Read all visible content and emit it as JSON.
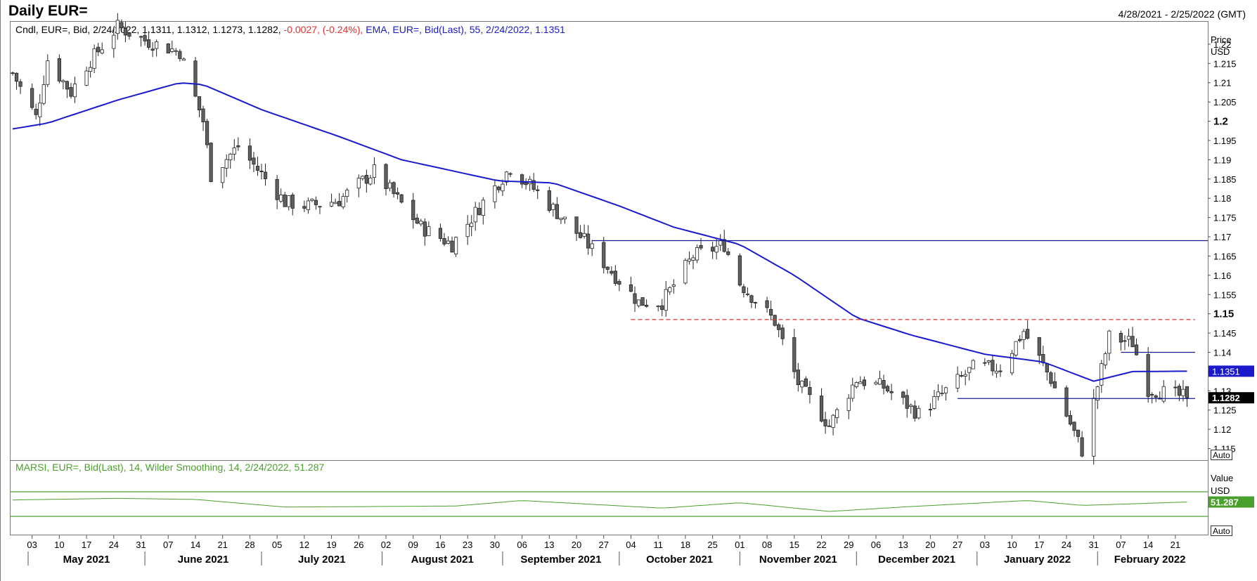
{
  "header": {
    "title": "Daily EUR=",
    "date_range": "4/28/2021 - 2/25/2022 (GMT)"
  },
  "legend": {
    "candle_info": "Cndl, EUR=, Bid, 2/24/2022, 1.1311, 1.1312, 1.1273, 1.1282,",
    "candle_change": "-0.0027, (-0.24%),",
    "ema_info": "EMA, EUR=, Bid(Last), 55, 2/24/2022, 1.1351",
    "rsi_info": "MARSI, EUR=, Bid(Last), 14, Wilder Smoothing, 14, 2/24/2022, 51.287"
  },
  "price_axis": {
    "title_line1": "Price",
    "title_line2": "USD",
    "ticks": [
      "1.22",
      "1.215",
      "1.21",
      "1.205",
      "1.2",
      "1.195",
      "1.19",
      "1.185",
      "1.18",
      "1.175",
      "1.17",
      "1.165",
      "1.16",
      "1.155",
      "1.15",
      "1.145",
      "1.14",
      "1.135",
      "1.13",
      "1.125",
      "1.12",
      "1.115"
    ],
    "bold_ticks": [
      "1.2",
      "1.15"
    ],
    "auto_label": "Auto",
    "ema_tag": "1.1351",
    "last_tag": "1.1282"
  },
  "rsi_axis": {
    "title_line1": "Value",
    "title_line2": "USD",
    "value_tag": "51.287",
    "auto_label": "Auto"
  },
  "x_axis": {
    "day_ticks": [
      "03",
      "10",
      "17",
      "24",
      "31",
      "07",
      "14",
      "21",
      "28",
      "05",
      "12",
      "19",
      "26",
      "02",
      "09",
      "16",
      "23",
      "30",
      "06",
      "13",
      "20",
      "27",
      "04",
      "11",
      "18",
      "25",
      "01",
      "08",
      "15",
      "22",
      "29",
      "06",
      "13",
      "20",
      "27",
      "03",
      "10",
      "17",
      "24",
      "31",
      "07",
      "14",
      "21"
    ],
    "months": [
      "May 2021",
      "June 2021",
      "July 2021",
      "August 2021",
      "September 2021",
      "October 2021",
      "November 2021",
      "December 2021",
      "January 2022",
      "February 2022"
    ]
  },
  "colors": {
    "up_candle": "#ffffff",
    "down_candle": "#606060",
    "ema": "#1a1acc",
    "rsi": "#4aa02c",
    "resistance_line": "#1a1a8c",
    "dashed_line": "#e03030",
    "change_text": "#e03030",
    "ema_text": "#1a1acc"
  },
  "chart_data": {
    "type": "candlestick",
    "title": "Daily EUR=",
    "instrument": "EUR=",
    "date_range": [
      "2021-04-28",
      "2022-02-25"
    ],
    "ylim": [
      1.112,
      1.226
    ],
    "last": {
      "date": "2/24/2022",
      "open": 1.1311,
      "high": 1.1312,
      "low": 1.1273,
      "close": 1.1282,
      "change": -0.0027,
      "change_pct": -0.24
    },
    "ema_period": 55,
    "ema_last": 1.1351,
    "rsi_period": 14,
    "rsi_last": 51.287,
    "close_path": [
      {
        "date": "2021-04-28",
        "v": 1.2125
      },
      {
        "date": "2021-05-04",
        "v": 1.201
      },
      {
        "date": "2021-05-07",
        "v": 1.216
      },
      {
        "date": "2021-05-13",
        "v": 1.2075
      },
      {
        "date": "2021-05-17",
        "v": 1.2145
      },
      {
        "date": "2021-05-25",
        "v": 1.2245
      },
      {
        "date": "2021-06-01",
        "v": 1.221
      },
      {
        "date": "2021-06-10",
        "v": 1.218
      },
      {
        "date": "2021-06-16",
        "v": 1.2
      },
      {
        "date": "2021-06-18",
        "v": 1.186
      },
      {
        "date": "2021-06-25",
        "v": 1.1935
      },
      {
        "date": "2021-07-07",
        "v": 1.179
      },
      {
        "date": "2021-07-13",
        "v": 1.178
      },
      {
        "date": "2021-07-21",
        "v": 1.1795
      },
      {
        "date": "2021-07-30",
        "v": 1.187
      },
      {
        "date": "2021-08-11",
        "v": 1.1725
      },
      {
        "date": "2021-08-19",
        "v": 1.168
      },
      {
        "date": "2021-08-27",
        "v": 1.179
      },
      {
        "date": "2021-09-03",
        "v": 1.188
      },
      {
        "date": "2021-09-10",
        "v": 1.1815
      },
      {
        "date": "2021-09-22",
        "v": 1.169
      },
      {
        "date": "2021-10-06",
        "v": 1.153
      },
      {
        "date": "2021-10-12",
        "v": 1.153
      },
      {
        "date": "2021-10-20",
        "v": 1.165
      },
      {
        "date": "2021-10-28",
        "v": 1.168
      },
      {
        "date": "2021-11-01",
        "v": 1.158
      },
      {
        "date": "2021-11-10",
        "v": 1.148
      },
      {
        "date": "2021-11-16",
        "v": 1.132
      },
      {
        "date": "2021-11-24",
        "v": 1.121
      },
      {
        "date": "2021-12-01",
        "v": 1.133
      },
      {
        "date": "2021-12-08",
        "v": 1.131
      },
      {
        "date": "2021-12-17",
        "v": 1.124
      },
      {
        "date": "2021-12-31",
        "v": 1.136
      },
      {
        "date": "2022-01-07",
        "v": 1.136
      },
      {
        "date": "2022-01-13",
        "v": 1.1455
      },
      {
        "date": "2022-01-20",
        "v": 1.133
      },
      {
        "date": "2022-01-28",
        "v": 1.1145
      },
      {
        "date": "2022-02-04",
        "v": 1.144
      },
      {
        "date": "2022-02-10",
        "v": 1.1425
      },
      {
        "date": "2022-02-14",
        "v": 1.1305
      },
      {
        "date": "2022-02-24",
        "v": 1.1282
      }
    ],
    "ema_series": [
      {
        "date": "2021-04-28",
        "v": 1.198
      },
      {
        "date": "2021-05-07",
        "v": 1.1995
      },
      {
        "date": "2021-05-25",
        "v": 1.2055
      },
      {
        "date": "2021-06-10",
        "v": 1.21
      },
      {
        "date": "2021-06-16",
        "v": 1.2095
      },
      {
        "date": "2021-07-01",
        "v": 1.203
      },
      {
        "date": "2021-07-21",
        "v": 1.196
      },
      {
        "date": "2021-08-06",
        "v": 1.19
      },
      {
        "date": "2021-08-31",
        "v": 1.1845
      },
      {
        "date": "2021-09-14",
        "v": 1.184
      },
      {
        "date": "2021-10-01",
        "v": 1.178
      },
      {
        "date": "2021-10-15",
        "v": 1.1725
      },
      {
        "date": "2021-11-01",
        "v": 1.168
      },
      {
        "date": "2021-11-15",
        "v": 1.16
      },
      {
        "date": "2021-12-01",
        "v": 1.149
      },
      {
        "date": "2021-12-15",
        "v": 1.1445
      },
      {
        "date": "2022-01-03",
        "v": 1.1395
      },
      {
        "date": "2022-01-18",
        "v": 1.1375
      },
      {
        "date": "2022-01-31",
        "v": 1.1325
      },
      {
        "date": "2022-02-10",
        "v": 1.135
      },
      {
        "date": "2022-02-24",
        "v": 1.1351
      }
    ],
    "rsi_series": [
      {
        "date": "2021-04-28",
        "v": 55
      },
      {
        "date": "2021-05-25",
        "v": 58
      },
      {
        "date": "2021-06-14",
        "v": 56
      },
      {
        "date": "2021-07-07",
        "v": 42
      },
      {
        "date": "2021-08-20",
        "v": 44
      },
      {
        "date": "2021-09-06",
        "v": 54
      },
      {
        "date": "2021-10-12",
        "v": 40
      },
      {
        "date": "2021-11-01",
        "v": 50
      },
      {
        "date": "2021-11-24",
        "v": 34
      },
      {
        "date": "2021-12-15",
        "v": 43
      },
      {
        "date": "2022-01-14",
        "v": 54
      },
      {
        "date": "2022-01-28",
        "v": 45
      },
      {
        "date": "2022-02-24",
        "v": 51.287
      }
    ],
    "horizontal_lines": [
      {
        "value": 1.169,
        "from": "2021-09-24",
        "style": "solid"
      },
      {
        "value": 1.1485,
        "from": "2021-10-04",
        "style": "dashed"
      },
      {
        "value": 1.14,
        "from": "2022-02-07",
        "style": "solid"
      },
      {
        "value": 1.128,
        "from": "2021-12-27",
        "style": "solid"
      }
    ]
  }
}
